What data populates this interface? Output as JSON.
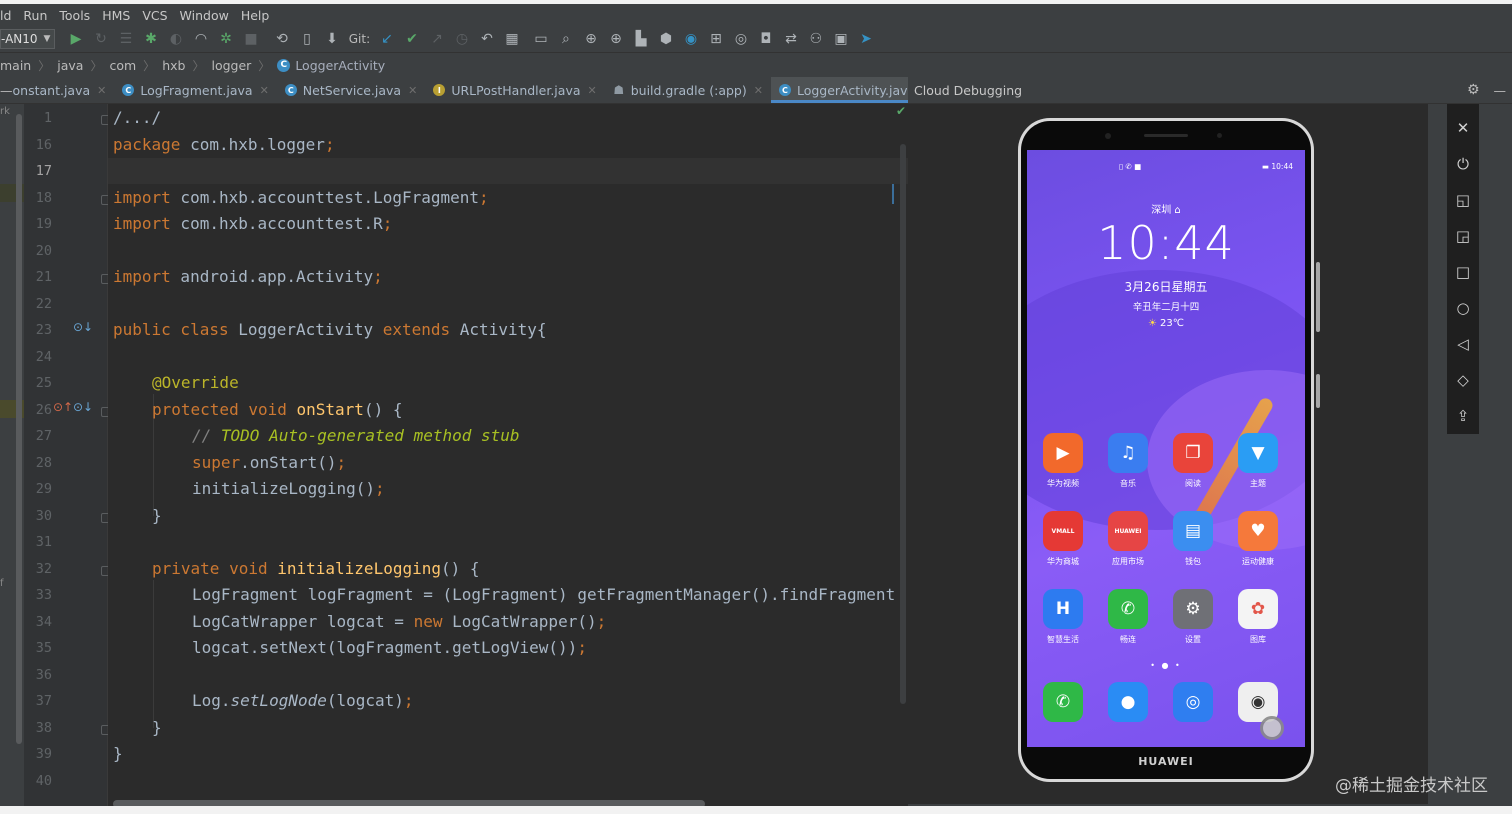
{
  "menubar": {
    "items": [
      "ld",
      "Run",
      "Tools",
      "HMS",
      "VCS",
      "Window",
      "Help"
    ]
  },
  "toolbar": {
    "run_config": "-AN10",
    "git_label": "Git:",
    "icons": [
      "run-icon",
      "rerun-icon",
      "coverage-icon",
      "debug-icon",
      "profile-icon",
      "attach-debugger-icon",
      "stop-icon",
      "sync-icon",
      "avd-manager-icon",
      "sdk-manager-icon",
      "git-update-icon",
      "git-commit-icon",
      "git-push-icon",
      "history-icon",
      "revert-icon",
      "project-structure-icon",
      "terminal-icon",
      "search-icon",
      "hms-toolkit-icon",
      "hms-add-icon",
      "hms-docs-icon",
      "hms-cloud-icon",
      "hms-crash-icon",
      "hms-find-icon",
      "hms-check-icon",
      "hms-convert-icon",
      "hms-upload-icon",
      "hms-debug-icon",
      "hms-device-icon",
      "hms-send-icon"
    ]
  },
  "breadcrumb": [
    "main",
    "java",
    "com",
    "hxb",
    "logger",
    "LoggerActivity"
  ],
  "tabs": [
    {
      "label": "onstant.java",
      "icon": "none"
    },
    {
      "label": "LogFragment.java",
      "icon": "C"
    },
    {
      "label": "NetService.java",
      "icon": "C"
    },
    {
      "label": "URLPostHandler.java",
      "icon": "I"
    },
    {
      "label": "build.gradle (:app)",
      "icon": "gradle"
    },
    {
      "label": "LoggerActivity.java",
      "icon": "C",
      "active": true
    }
  ],
  "left_strip": {
    "vertical_text": "rk",
    "letter": "f"
  },
  "editor": {
    "line_numbers": [
      "1",
      "16",
      "17",
      "18",
      "19",
      "20",
      "21",
      "22",
      "23",
      "24",
      "25",
      "26",
      "27",
      "28",
      "29",
      "30",
      "31",
      "32",
      "33",
      "34",
      "35",
      "36",
      "37",
      "38",
      "39",
      "40"
    ],
    "current_line": "17",
    "code": {
      "l1": "/.../",
      "l16_kw": "package",
      "l16_rest": " com.hxb.logger",
      "l16_semi": ";",
      "l18_kw": "import",
      "l18_rest": " com.hxb.accounttest.LogFragment",
      "l18_semi": ";",
      "l19_kw": "import",
      "l19_rest": " com.hxb.accounttest.R",
      "l19_semi": ";",
      "l21_kw": "import",
      "l21_rest": " android.app.Activity",
      "l21_semi": ";",
      "l23_kw1": "public class",
      "l23_name": " LoggerActivity ",
      "l23_kw2": "extends",
      "l23_rest": " Activity{",
      "l25_anno": "@Override",
      "l26_kw": "protected void ",
      "l26_fn": "onStart",
      "l26_rest": "() {",
      "l27_cm": "// ",
      "l27_todo": "TODO Auto-generated method stub",
      "l28_kw": "super",
      "l28_rest": ".onStart()",
      "l28_semi": ";",
      "l29_rest": "initializeLogging()",
      "l29_semi": ";",
      "l30": "}",
      "l32_kw": "private void ",
      "l32_fn": "initializeLogging",
      "l32_rest": "() {",
      "l33": "LogFragment logFragment = (LogFragment) getFragmentManager().findFragment",
      "l34_a": "LogCatWrapper logcat = ",
      "l34_kw": "new",
      "l34_b": " LogCatWrapper()",
      "l34_semi": ";",
      "l35": "logcat.setNext(logFragment.getLogView())",
      "l35_semi": ";",
      "l37_a": "Log.",
      "l37_it": "setLogNode",
      "l37_b": "(logcat)",
      "l37_semi": ";",
      "l38": "}",
      "l39": "}"
    }
  },
  "cloud_panel": {
    "title": "Cloud Debugging",
    "side_tools": [
      "close-icon",
      "power-icon",
      "rotate-left-icon",
      "rotate-right-icon",
      "square-nav-icon",
      "home-circle-icon",
      "back-triangle-icon",
      "tag-icon",
      "upload-icon"
    ],
    "watermark": "@稀土掘金技术社区"
  },
  "phone": {
    "status_left": "▯ ✆ ■",
    "status_right": "▬ 10:44",
    "city": "深圳 ⌂",
    "time": "10:44",
    "date": "3月26日星期五",
    "lunar": "辛丑年二月十四",
    "weather": "23℃",
    "brand": "HUAWEI",
    "apps": [
      {
        "label": "华为视频",
        "color": "#f2692b",
        "glyph": "▶"
      },
      {
        "label": "音乐",
        "color": "#3a7df0",
        "glyph": "♫"
      },
      {
        "label": "阅读",
        "color": "#e9443a",
        "glyph": "❐"
      },
      {
        "label": "主题",
        "color": "#2a9df4",
        "glyph": "▼"
      },
      {
        "label": "华为商城",
        "color": "#e53935",
        "glyph": "VMALL"
      },
      {
        "label": "应用市场",
        "color": "#e64545",
        "glyph": "HUAWEI"
      },
      {
        "label": "钱包",
        "color": "#3b8ef0",
        "glyph": "▤"
      },
      {
        "label": "运动健康",
        "color": "#f5793b",
        "glyph": "♥"
      },
      {
        "label": "智慧生活",
        "color": "#2d7bf0",
        "glyph": "H"
      },
      {
        "label": "畅连",
        "color": "#2fb847",
        "glyph": "✆"
      },
      {
        "label": "设置",
        "color": "#6f7076",
        "glyph": "⚙"
      },
      {
        "label": "图库",
        "color": "#f4f4f4",
        "glyph": "✿"
      }
    ],
    "dock": [
      {
        "color": "#2fb847",
        "glyph": "✆"
      },
      {
        "color": "#2a8cf4",
        "glyph": "●"
      },
      {
        "color": "#2f7ef0",
        "glyph": "◎"
      },
      {
        "color": "#efefef",
        "glyph": "◉"
      }
    ],
    "page_dots": "• ● •"
  }
}
